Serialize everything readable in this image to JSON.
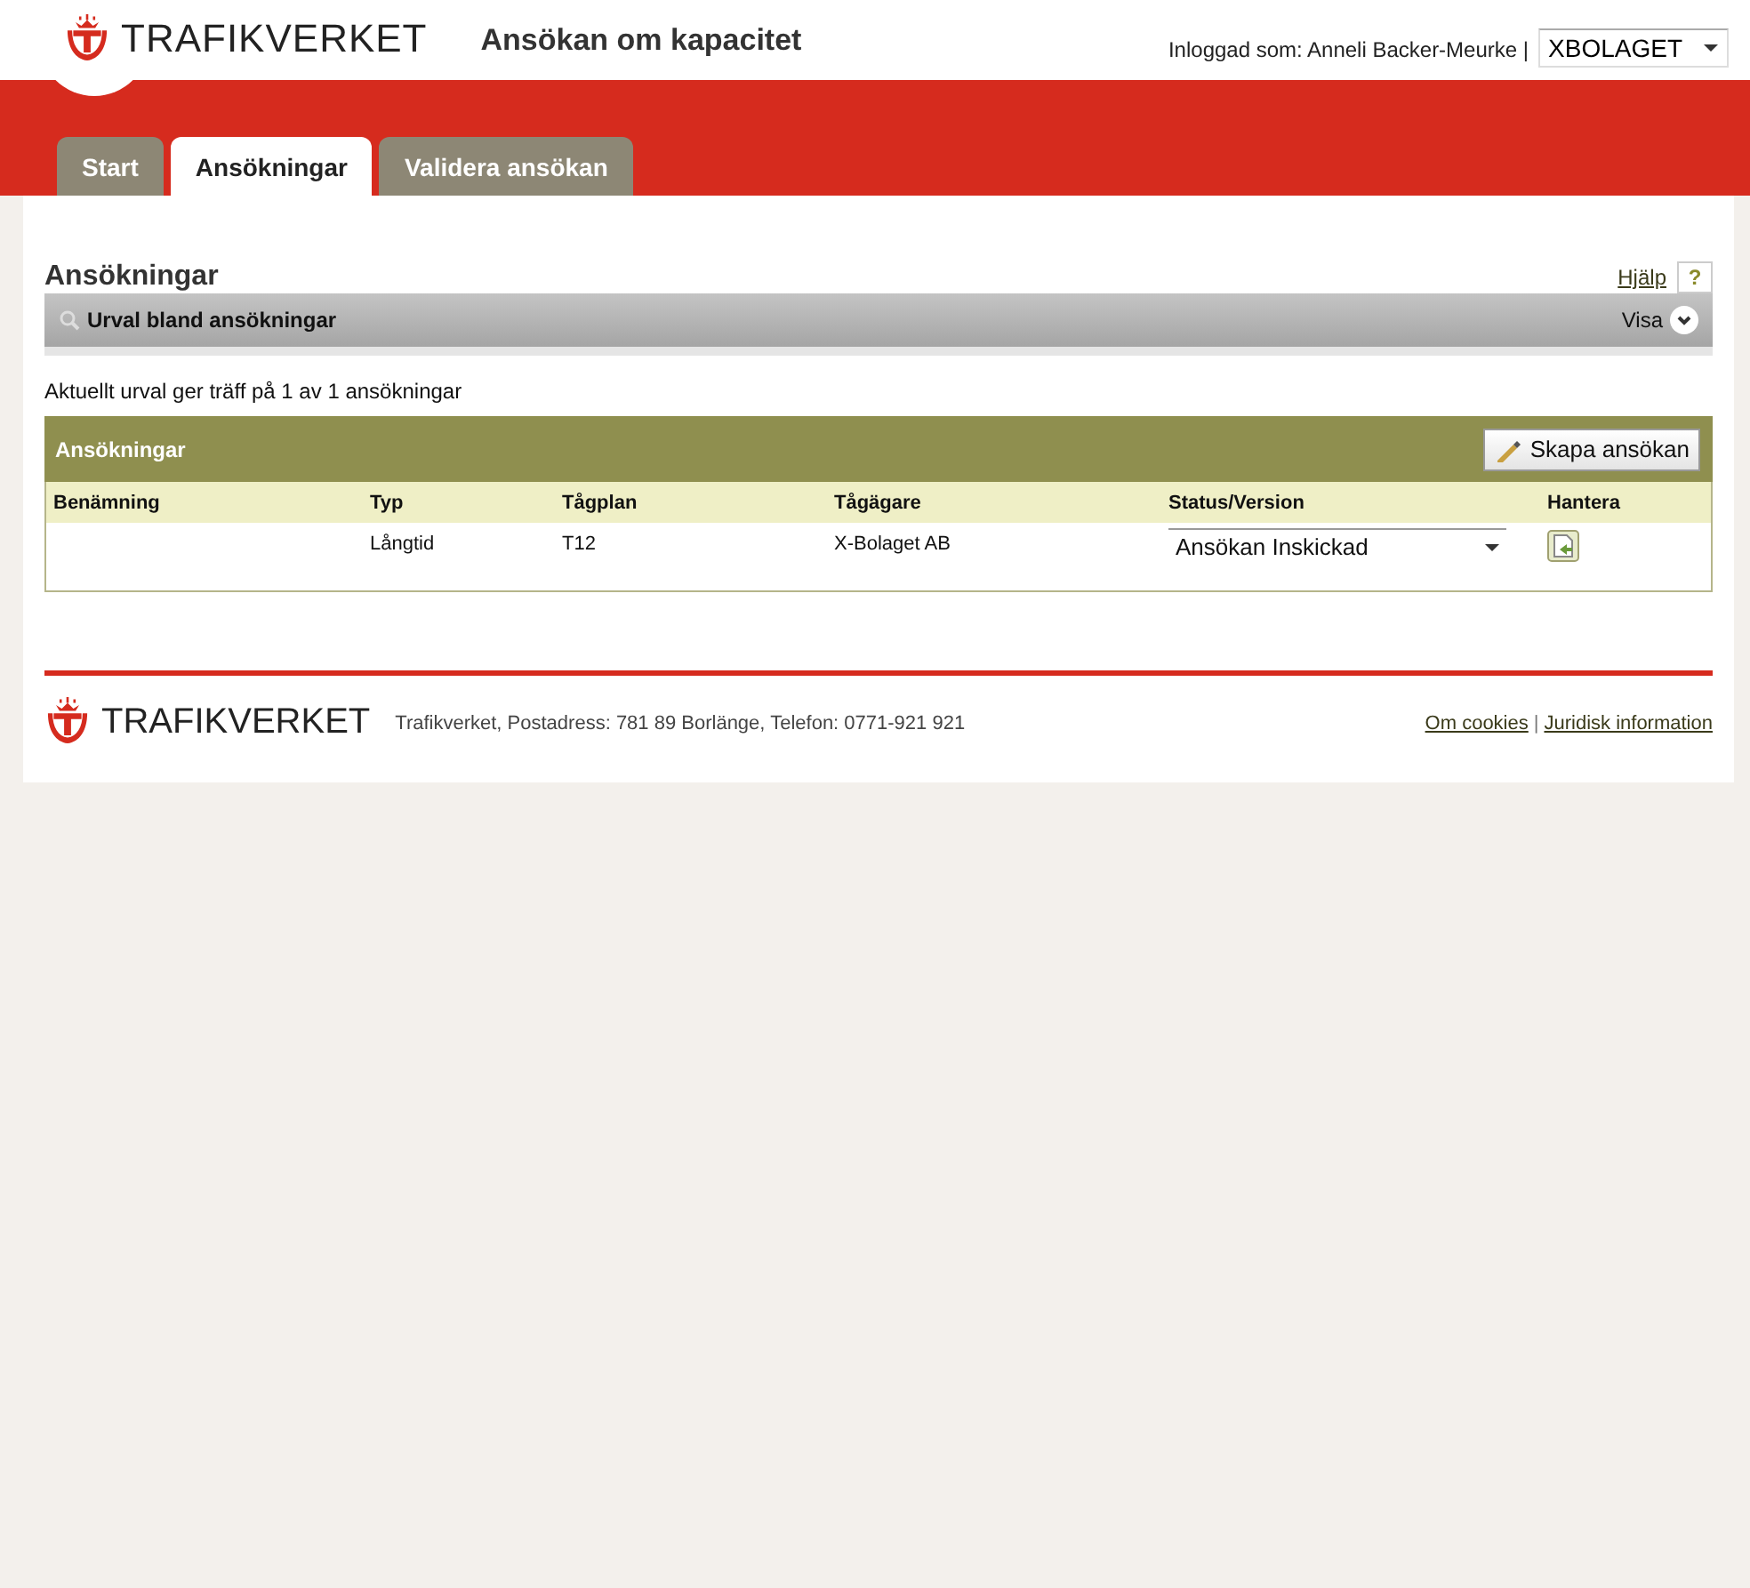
{
  "header": {
    "logo": "TRAFIKVERKET",
    "title": "Ansökan om kapacitet",
    "user": "Inloggad som: Anneli Backer-Meurke |",
    "organisation": {
      "value": "XBOLAGET"
    }
  },
  "tabs": [
    {
      "label": "Start",
      "selected": false
    },
    {
      "label": "Ansökningar",
      "selected": true
    },
    {
      "label": "Validera ansökan",
      "selected": false
    }
  ],
  "page": {
    "heading": "Ansökningar",
    "help_link": "Hjälp",
    "help_button": "?"
  },
  "filter_bar": {
    "title": "Urval bland ansökningar",
    "toggle": "Visa"
  },
  "result_text": "Aktuellt urval ger träff på 1 av 1 ansökningar",
  "table": {
    "title": "Ansökningar",
    "create_button": "Skapa ansökan",
    "columns": [
      "Benämning",
      "Typ",
      "Tågplan",
      "Tågägare",
      "Status/Version",
      "Hantera"
    ],
    "rows": [
      {
        "type": "Långtid",
        "plan": "T12",
        "owner": "X-Bolaget AB",
        "status": "Ansökan Inskickad"
      }
    ]
  },
  "footer": {
    "logo": "TRAFIKVERKET",
    "address": "Trafikverket, Postadress: 781 89 Borlänge, Telefon: 0771-921 921",
    "links": [
      "Om cookies",
      "Juridisk information"
    ],
    "separator": "|"
  }
}
